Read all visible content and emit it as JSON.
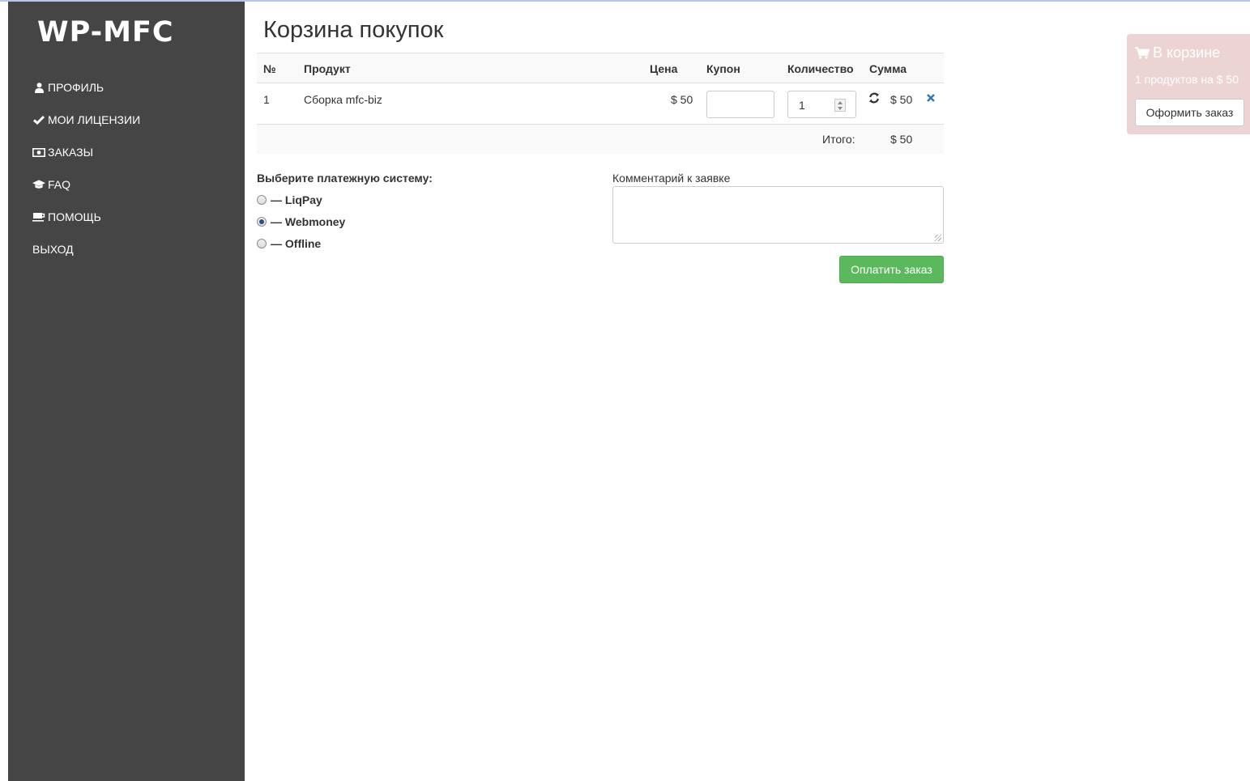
{
  "sidebar": {
    "logo": "WP-MFC",
    "items": [
      {
        "label": "ПРОФИЛЬ",
        "icon": "user-icon"
      },
      {
        "label": "МОИ ЛИЦЕНЗИИ",
        "icon": "check-icon"
      },
      {
        "label": "ЗАКАЗЫ",
        "icon": "money-icon"
      },
      {
        "label": "FAQ",
        "icon": "graduation-cap-icon"
      },
      {
        "label": "ПОМОЩЬ",
        "icon": "coffee-icon"
      },
      {
        "label": "ВЫХОД",
        "icon": ""
      }
    ]
  },
  "main": {
    "title": "Корзина покупок"
  },
  "cart": {
    "headers": {
      "num": "№",
      "product": "Продукт",
      "price": "Цена",
      "coupon": "Купон",
      "quantity": "Количество",
      "sum": "Сумма"
    },
    "rows": [
      {
        "num": "1",
        "product": "Сборка mfc-biz",
        "price": "$ 50",
        "coupon": "",
        "quantity": "1",
        "sum": "$ 50"
      }
    ],
    "total_label": "Итого:",
    "total_value": "$ 50"
  },
  "payment": {
    "title": "Выберите платежную систему:",
    "options": [
      {
        "label": "— LiqPay",
        "checked": false
      },
      {
        "label": "— Webmoney",
        "checked": true
      },
      {
        "label": "— Offline",
        "checked": false
      }
    ]
  },
  "comment": {
    "label": "Комментарий к заявке",
    "value": ""
  },
  "pay_button": "Оплатить заказ",
  "mini_cart": {
    "title": "В корзине",
    "summary": "1 продуктов на $ 50",
    "checkout_button": "Оформить заказ"
  },
  "colors": {
    "sidebar_bg": "#454545",
    "success": "#5cb85c",
    "mini_cart_bg": "#ecd4d4",
    "link_blue": "#337ab7"
  }
}
